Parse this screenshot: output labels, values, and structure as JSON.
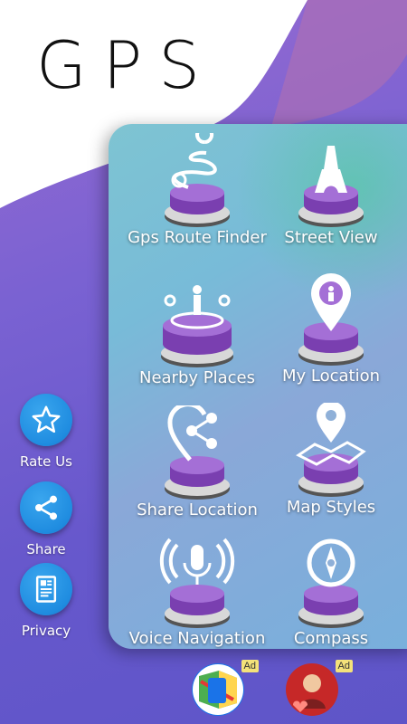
{
  "app": {
    "title": "GPS"
  },
  "tiles": [
    {
      "label": "Gps Route Finder",
      "icon": "route-icon"
    },
    {
      "label": "Street View",
      "icon": "eiffel-tower-icon"
    },
    {
      "label": "Nearby Places",
      "icon": "nearby-people-icon"
    },
    {
      "label": "My Location",
      "icon": "location-person-icon"
    },
    {
      "label": "Share Location",
      "icon": "share-pin-icon"
    },
    {
      "label": "Map Styles",
      "icon": "map-pin-icon"
    },
    {
      "label": "Voice Navigation",
      "icon": "microphone-icon"
    },
    {
      "label": "Compass",
      "icon": "compass-icon"
    }
  ],
  "side": [
    {
      "label": "Rate Us",
      "icon": "star-icon"
    },
    {
      "label": "Share",
      "icon": "share-icon"
    },
    {
      "label": "Privacy",
      "icon": "document-icon"
    }
  ],
  "ads": [
    {
      "badge": "Ad",
      "icon": "maps-app-icon"
    },
    {
      "badge": "Ad",
      "icon": "love-frames-app-icon"
    }
  ],
  "colors": {
    "accent_purple": "#8e54c8",
    "side_button_blue": "#1f8ce0",
    "panel_teal": "#7ec4d2"
  }
}
